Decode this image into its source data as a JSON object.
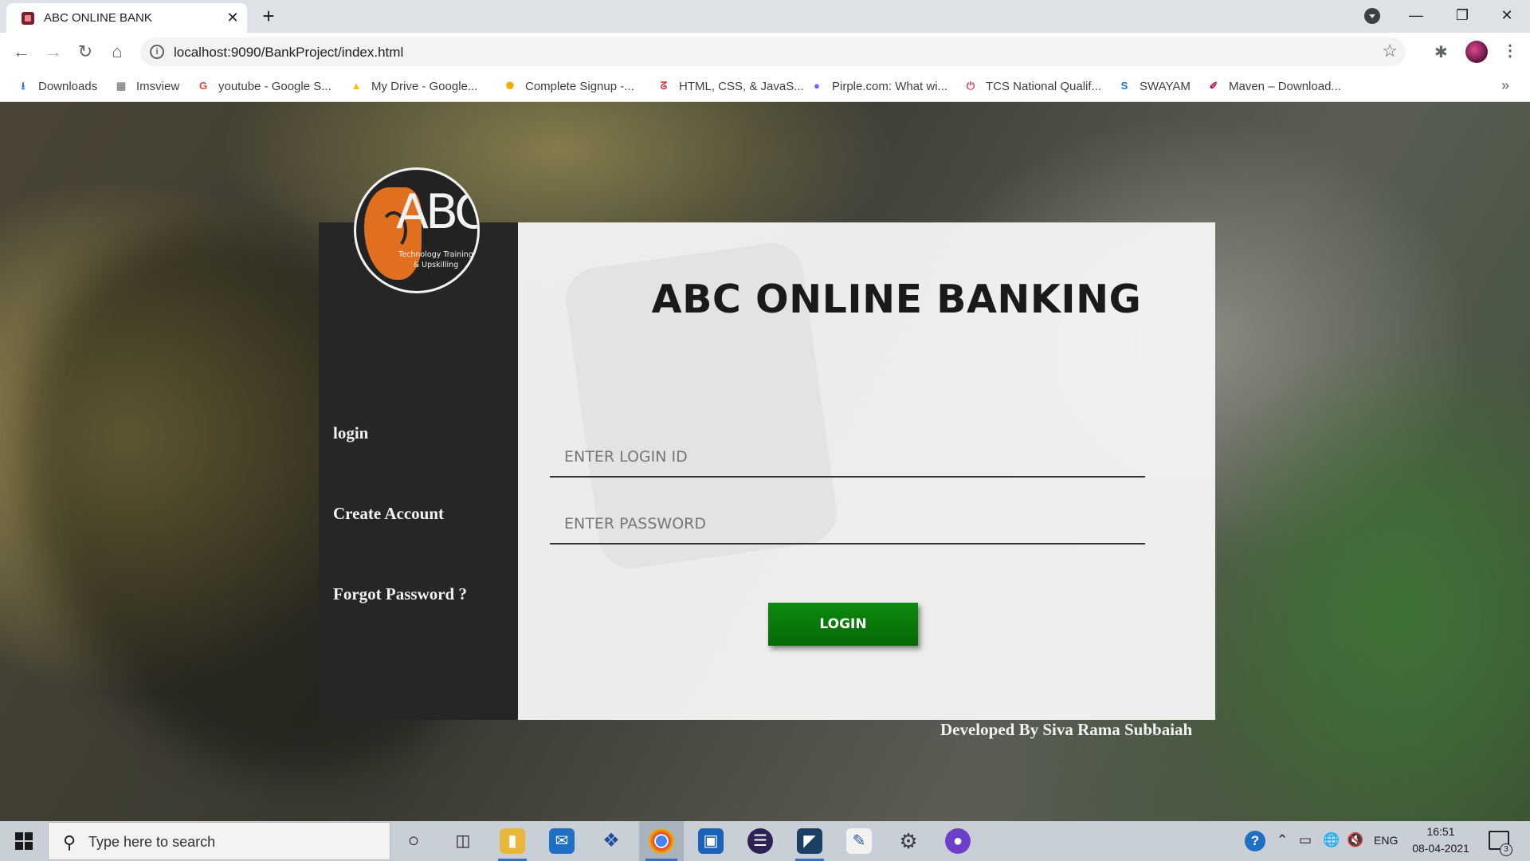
{
  "browser": {
    "tab_title": "ABC ONLINE BANK",
    "tab_close": "✕",
    "new_tab": "+",
    "url": "localhost:9090/BankProject/index.html",
    "bookmarks": [
      {
        "label": "Downloads",
        "icon": "download-icon",
        "color": "#1a73e8",
        "glyph": "⭳"
      },
      {
        "label": "Imsview",
        "icon": "grid-icon",
        "color": "#8a8a8a",
        "glyph": "▦"
      },
      {
        "label": "youtube - Google S...",
        "icon": "google-icon",
        "color": "#ea4335",
        "glyph": "G"
      },
      {
        "label": "My Drive - Google...",
        "icon": "drive-icon",
        "color": "#fbbc04",
        "glyph": "▲"
      },
      {
        "label": "Complete Signup -...",
        "icon": "sun-icon",
        "color": "#f2a900",
        "glyph": "✺"
      },
      {
        "label": "HTML, CSS, & JavaS...",
        "icon": "udemy-icon",
        "color": "#d6333b",
        "glyph": "ᘔ"
      },
      {
        "label": "Pirple.com: What wi...",
        "icon": "pirple-icon",
        "color": "#7c5cff",
        "glyph": "●"
      },
      {
        "label": "TCS National Qualif...",
        "icon": "power-icon",
        "color": "#e8334a",
        "glyph": "⏻"
      },
      {
        "label": "SWAYAM",
        "icon": "swayam-icon",
        "color": "#1a73e8",
        "glyph": "S"
      },
      {
        "label": "Maven – Download...",
        "icon": "feather-icon",
        "color": "#c2185b",
        "glyph": "✐"
      }
    ]
  },
  "logo": {
    "text": "ABC",
    "tagline_1": "Technology Training",
    "tagline_2": "& Upskilling"
  },
  "sidebar": {
    "links": [
      "login",
      "Create Account",
      "Forgot Password ?"
    ]
  },
  "main": {
    "title": "ABC ONLINE BANKING",
    "login_placeholder": "ENTER LOGIN ID",
    "password_placeholder": "ENTER PASSWORD",
    "login_button": "LOGIN"
  },
  "footer": {
    "credit": "Developed By Siva Rama Subbaiah"
  },
  "taskbar": {
    "search_placeholder": "Type here to search",
    "tray_lang": "ENG",
    "time": "16:51",
    "date": "08-04-2021",
    "notification_count": "3"
  }
}
